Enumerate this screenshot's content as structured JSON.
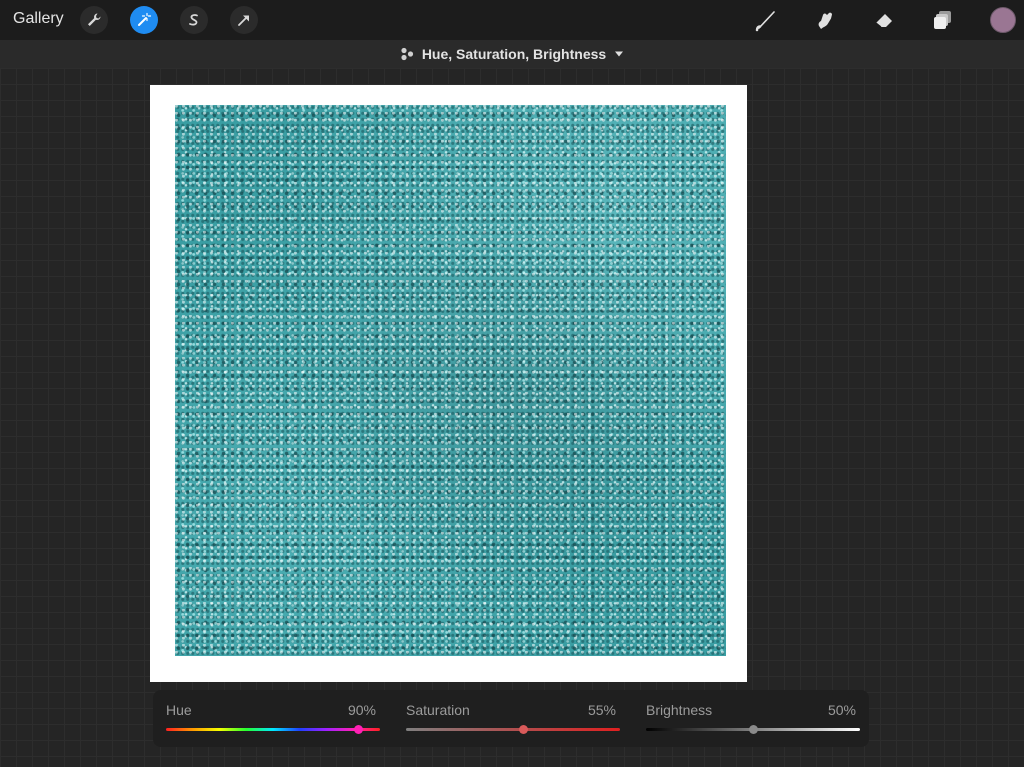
{
  "topbar": {
    "gallery_label": "Gallery",
    "tools": [
      {
        "icon": "wrench-icon",
        "active": false
      },
      {
        "icon": "magic-wand-icon",
        "active": true
      },
      {
        "icon": "selection-s-icon",
        "active": false
      },
      {
        "icon": "transform-arrow-icon",
        "active": false
      }
    ],
    "right_tools": [
      "brush-icon",
      "smudge-icon",
      "eraser-icon",
      "layers-icon"
    ],
    "current_color": "#9a7693",
    "accent_color": "#1f8cf2"
  },
  "adjustment": {
    "title": "Hue, Saturation, Brightness",
    "icon": "adjustments-dots-icon"
  },
  "canvas": {
    "content": "teal glitter texture",
    "frame_color": "#ffffff",
    "fill_color": "#3a9ea3"
  },
  "sliders": {
    "hue": {
      "label": "Hue",
      "value_text": "90%",
      "value": 0.9,
      "knob_color": "#ff20b4"
    },
    "saturation": {
      "label": "Saturation",
      "value_text": "55%",
      "value": 0.55,
      "knob_color": "#d95a5a"
    },
    "brightness": {
      "label": "Brightness",
      "value_text": "50%",
      "value": 0.5,
      "knob_color": "#8a8a8a"
    }
  }
}
